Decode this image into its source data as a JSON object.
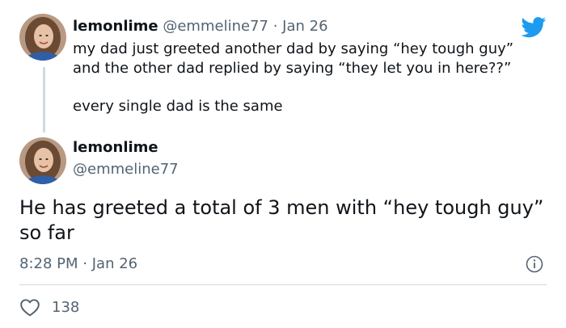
{
  "tweet1": {
    "display_name": "lemonlime",
    "handle": "@emmeline77",
    "separator": "·",
    "date": "Jan 26",
    "lines": [
      "my dad just greeted another dad by saying “hey tough guy”",
      "and the other dad replied by saying “they let you in here??”"
    ],
    "second_paragraph": "every single dad is the same"
  },
  "tweet2": {
    "display_name": "lemonlime",
    "handle": "@emmeline77",
    "body": "He has greeted a total of 3 men with “hey tough guy” so far",
    "time": "8:28 PM",
    "separator": "·",
    "date": "Jan 26",
    "like_count": "138"
  },
  "icons": {
    "logo": "twitter-bird-icon",
    "info": "info-icon",
    "like": "heart-icon"
  },
  "colors": {
    "brand_blue": "#1d9bf0",
    "text": "#0f1419",
    "muted": "#536471",
    "border": "#cfd9de"
  }
}
